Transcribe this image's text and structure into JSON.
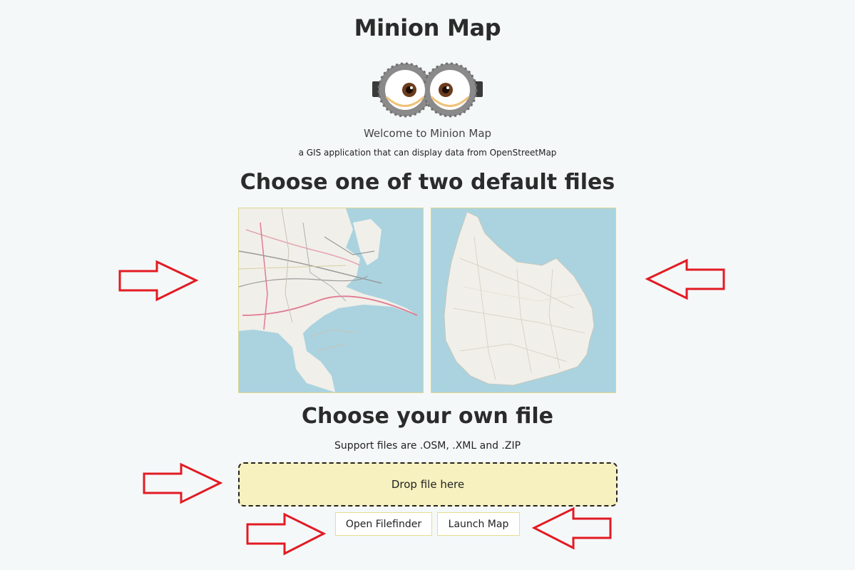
{
  "header": {
    "title": "Minion Map",
    "welcome": "Welcome to Minion Map",
    "tagline": "a GIS application that can display data from OpenStreetMap"
  },
  "defaults": {
    "heading": "Choose one of two default files",
    "maps": [
      {
        "icon": "map-thumbnail-copenhagen"
      },
      {
        "icon": "map-thumbnail-bornholm"
      }
    ]
  },
  "own_file": {
    "heading": "Choose your own file",
    "support_text": "Support files are .OSM, .XML and .ZIP",
    "dropzone_label": "Drop file here"
  },
  "buttons": {
    "open_filefinder": "Open Filefinder",
    "launch_map": "Launch Map"
  },
  "colors": {
    "background": "#f5f8f9",
    "water": "#aad3df",
    "land": "#f1efe9",
    "dropzone": "#f7f1bf",
    "annotation_arrow": "#e21b23"
  }
}
